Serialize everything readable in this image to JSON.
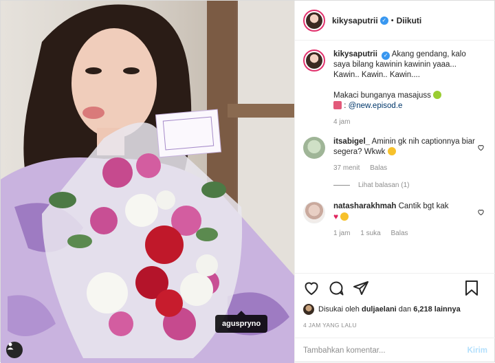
{
  "post": {
    "username": "kikysaputrii",
    "follow_status": "Diikuti",
    "separator": "•",
    "photo_user_tag": "aguspryno",
    "caption": {
      "username": "kikysaputrii",
      "line1": "Akang gendang, kalo saya bilang kawinin kawinin yaaa... Kawin.. Kawin.. Kawin....",
      "line2": "Makaci bunganya masajuss",
      "line3_mention": "@new.episod.e",
      "time": "4 jam"
    },
    "comments": [
      {
        "username": "itsabigel_",
        "text": "Aminin gk nih captionnya biar segera? Wkwk",
        "time": "37 menit",
        "reply_label": "Balas",
        "view_replies": "Lihat balasan (1)"
      },
      {
        "username": "natasharakhmah",
        "text": "Cantik bgt kak",
        "time": "1 jam",
        "likes": "1 suka",
        "reply_label": "Balas"
      }
    ],
    "likes": {
      "prefix": "Disukai oleh",
      "first_user": "duljaelani",
      "connector": "dan",
      "others": "6,218 lainnya"
    },
    "timestamp": "4 JAM YANG LALU",
    "add_comment": {
      "placeholder": "Tambahkan komentar...",
      "post_label": "Kirim"
    }
  },
  "colors": {
    "verified": "#3897f0",
    "link": "#00376b",
    "muted": "#8e8e8e",
    "post_button_disabled": "#b2dffc"
  },
  "icons": [
    "verified-badge-icon",
    "heart-icon",
    "comment-icon",
    "share-icon",
    "bookmark-icon",
    "user-tag-icon",
    "small-heart-icon"
  ]
}
